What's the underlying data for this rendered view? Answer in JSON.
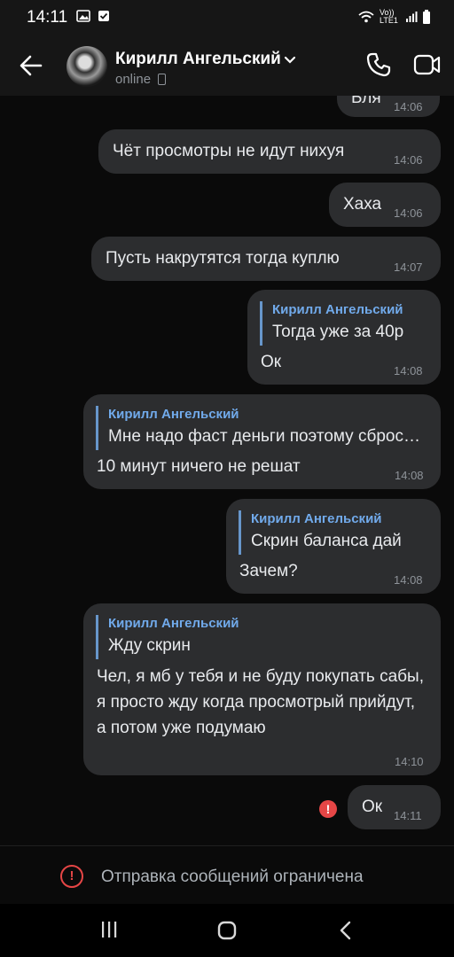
{
  "status_bar": {
    "time": "14:11",
    "network_label": "Vo)) LTE1"
  },
  "header": {
    "contact_name": "Кирилл Ангельский",
    "status": "online"
  },
  "messages": [
    {
      "text": "Бля",
      "time": "14:06",
      "outgoing": true
    },
    {
      "text": "Чёт просмотры не идут нихуя",
      "time": "14:06",
      "outgoing": false
    },
    {
      "text": "Хаха",
      "time": "14:06",
      "outgoing": true
    },
    {
      "text": "Пусть накрутятся тогда куплю",
      "time": "14:07",
      "outgoing": false
    },
    {
      "reply_name": "Кирилл Ангельский",
      "reply_text": "Тогда уже за 40р",
      "text": "Ок",
      "time": "14:08",
      "outgoing": true
    },
    {
      "reply_name": "Кирилл Ангельский",
      "reply_text": "Мне надо фаст деньги поэтому сбросил цену",
      "text": "10 минут ничего не решат",
      "time": "14:08",
      "outgoing": false
    },
    {
      "reply_name": "Кирилл Ангельский",
      "reply_text": "Скрин баланса дай",
      "text": "Зачем?",
      "time": "14:08",
      "outgoing": true
    },
    {
      "reply_name": "Кирилл Ангельский",
      "reply_text": "Жду скрин",
      "text": "Чел, я мб у тебя и не буду покупать сабы, я просто жду когда просмотрый прийдут, а потом уже подумаю",
      "time": "14:10",
      "outgoing": false
    },
    {
      "text": "Ок",
      "time": "14:11",
      "outgoing": true,
      "failed": true
    }
  ],
  "footer": {
    "notice": "Отправка сообщений ограничена"
  },
  "colors": {
    "bubble": "#2c2d2f",
    "accent": "#71aaeb",
    "error": "#e64646",
    "background": "#0a0a0a"
  }
}
